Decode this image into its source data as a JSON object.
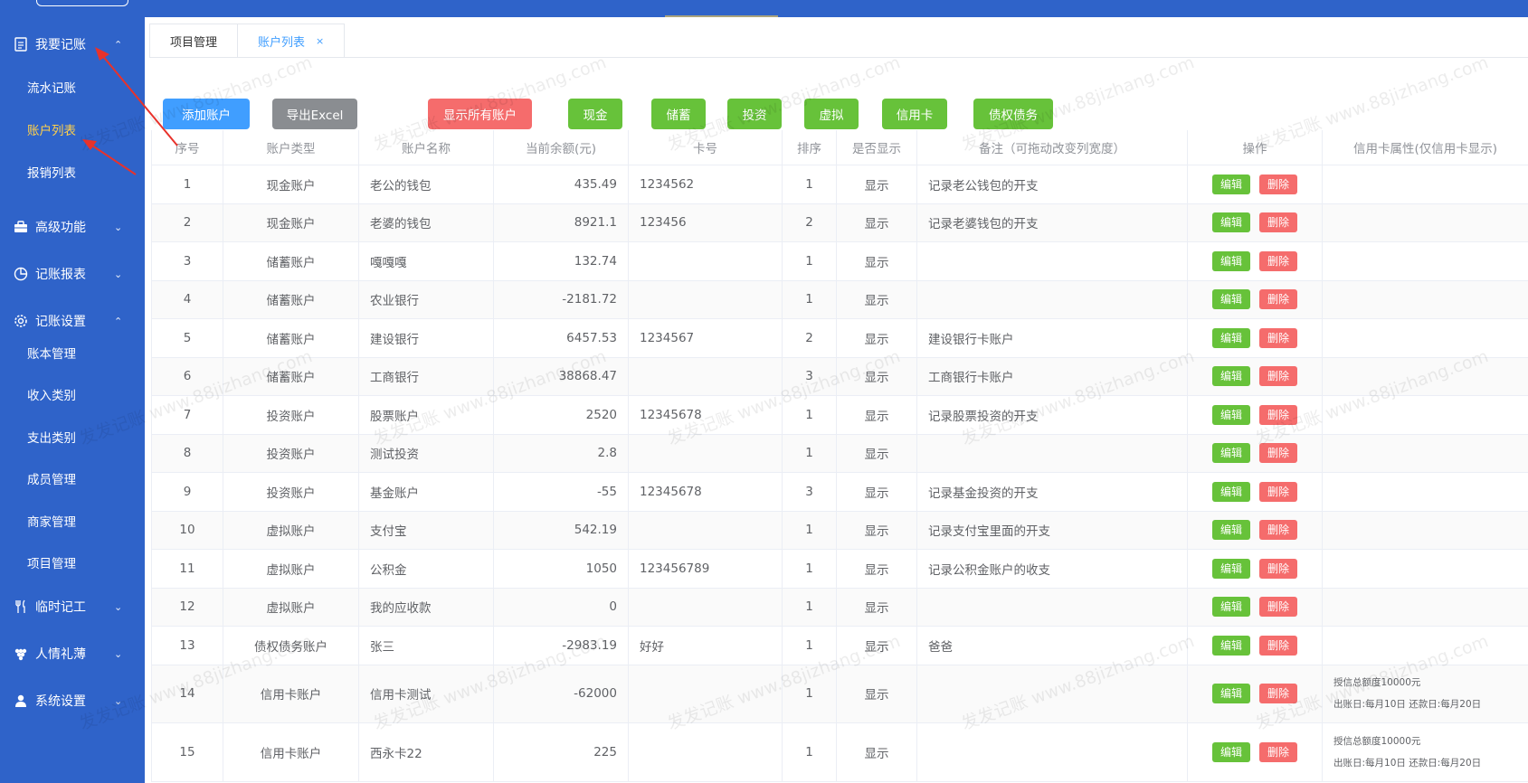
{
  "sidebar": {
    "groups": {
      "bookkeeping": {
        "label": "我要记账",
        "icon": "document-icon",
        "chevron": "⌃"
      },
      "advanced": {
        "label": "高级功能",
        "icon": "briefcase-icon",
        "chevron": "⌄"
      },
      "reports": {
        "label": "记账报表",
        "icon": "pie-chart-icon",
        "chevron": "⌄"
      },
      "settings": {
        "label": "记账设置",
        "icon": "gear-icon",
        "chevron": "⌃"
      },
      "temp": {
        "label": "临时记工",
        "icon": "utensils-icon",
        "chevron": "⌄"
      },
      "gifts": {
        "label": "人情礼薄",
        "icon": "grapes-icon",
        "chevron": "⌄"
      },
      "system": {
        "label": "系统设置",
        "icon": "user-icon",
        "chevron": "⌄"
      }
    },
    "bookkeeping_items": [
      "流水记账",
      "账户列表",
      "报销列表"
    ],
    "settings_items": [
      "账本管理",
      "收入类别",
      "支出类别",
      "成员管理",
      "商家管理",
      "项目管理"
    ]
  },
  "tabs": [
    {
      "label": "项目管理"
    },
    {
      "label": "账户列表",
      "close": "×"
    }
  ],
  "toolbar": {
    "add": "添加账户",
    "export": "导出Excel",
    "show_all": "显示所有账户",
    "filters": [
      "现金",
      "储蓄",
      "投资",
      "虚拟",
      "信用卡",
      "债权债务"
    ]
  },
  "table": {
    "headers": [
      "序号",
      "账户类型",
      "账户名称",
      "当前余额(元)",
      "卡号",
      "排序",
      "是否显示",
      "备注（可拖动改变列宽度）",
      "操作",
      "信用卡属性(仅信用卡显示)"
    ],
    "edit_label": "编辑",
    "delete_label": "删除",
    "rows": [
      {
        "no": "1",
        "type": "现金账户",
        "name": "老公的钱包",
        "balance": "435.49",
        "card": "1234562",
        "order": "1",
        "show": "显示",
        "note": "记录老公钱包的开支"
      },
      {
        "no": "2",
        "type": "现金账户",
        "name": "老婆的钱包",
        "balance": "8921.1",
        "card": "123456",
        "order": "2",
        "show": "显示",
        "note": "记录老婆钱包的开支"
      },
      {
        "no": "3",
        "type": "储蓄账户",
        "name": "嘎嘎嘎",
        "balance": "132.74",
        "card": "",
        "order": "1",
        "show": "显示",
        "note": ""
      },
      {
        "no": "4",
        "type": "储蓄账户",
        "name": "农业银行",
        "balance": "-2181.72",
        "card": "",
        "order": "1",
        "show": "显示",
        "note": ""
      },
      {
        "no": "5",
        "type": "储蓄账户",
        "name": "建设银行",
        "balance": "6457.53",
        "card": "1234567",
        "order": "2",
        "show": "显示",
        "note": "建设银行卡账户"
      },
      {
        "no": "6",
        "type": "储蓄账户",
        "name": "工商银行",
        "balance": "38868.47",
        "card": "",
        "order": "3",
        "show": "显示",
        "note": "工商银行卡账户"
      },
      {
        "no": "7",
        "type": "投资账户",
        "name": "股票账户",
        "balance": "2520",
        "card": "12345678",
        "order": "1",
        "show": "显示",
        "note": "记录股票投资的开支"
      },
      {
        "no": "8",
        "type": "投资账户",
        "name": "测试投资",
        "balance": "2.8",
        "card": "",
        "order": "1",
        "show": "显示",
        "note": ""
      },
      {
        "no": "9",
        "type": "投资账户",
        "name": "基金账户",
        "balance": "-55",
        "card": "12345678",
        "order": "3",
        "show": "显示",
        "note": "记录基金投资的开支"
      },
      {
        "no": "10",
        "type": "虚拟账户",
        "name": "支付宝",
        "balance": "542.19",
        "card": "",
        "order": "1",
        "show": "显示",
        "note": "记录支付宝里面的开支"
      },
      {
        "no": "11",
        "type": "虚拟账户",
        "name": "公积金",
        "balance": "1050",
        "card": "123456789",
        "order": "1",
        "show": "显示",
        "note": "记录公积金账户的收支"
      },
      {
        "no": "12",
        "type": "虚拟账户",
        "name": "我的应收款",
        "balance": "0",
        "card": "",
        "order": "1",
        "show": "显示",
        "note": ""
      },
      {
        "no": "13",
        "type": "债权债务账户",
        "name": "张三",
        "balance": "-2983.19",
        "card": "好好",
        "order": "1",
        "show": "显示",
        "note": "爸爸"
      },
      {
        "no": "14",
        "type": "信用卡账户",
        "name": "信用卡测试",
        "balance": "-62000",
        "card": "",
        "order": "1",
        "show": "显示",
        "note": "",
        "credit_limit": "授信总额度10000元",
        "credit_days": "出账日:每月10日  还款日:每月20日"
      },
      {
        "no": "15",
        "type": "信用卡账户",
        "name": "西永卡22",
        "balance": "225",
        "card": "",
        "order": "1",
        "show": "显示",
        "note": "",
        "credit_limit": "授信总额度10000元",
        "credit_days": "出账日:每月10日  还款日:每月20日"
      }
    ]
  },
  "watermark": "发发记账 www.88jizhang.com",
  "colors": {
    "sidebar": "#2f63c9",
    "active_menu": "#ffd04b",
    "primary": "#409eff",
    "danger": "#f56c6c",
    "success": "#67c23a",
    "info": "#8a8d91",
    "annotation_arrow": "#e8322b"
  }
}
